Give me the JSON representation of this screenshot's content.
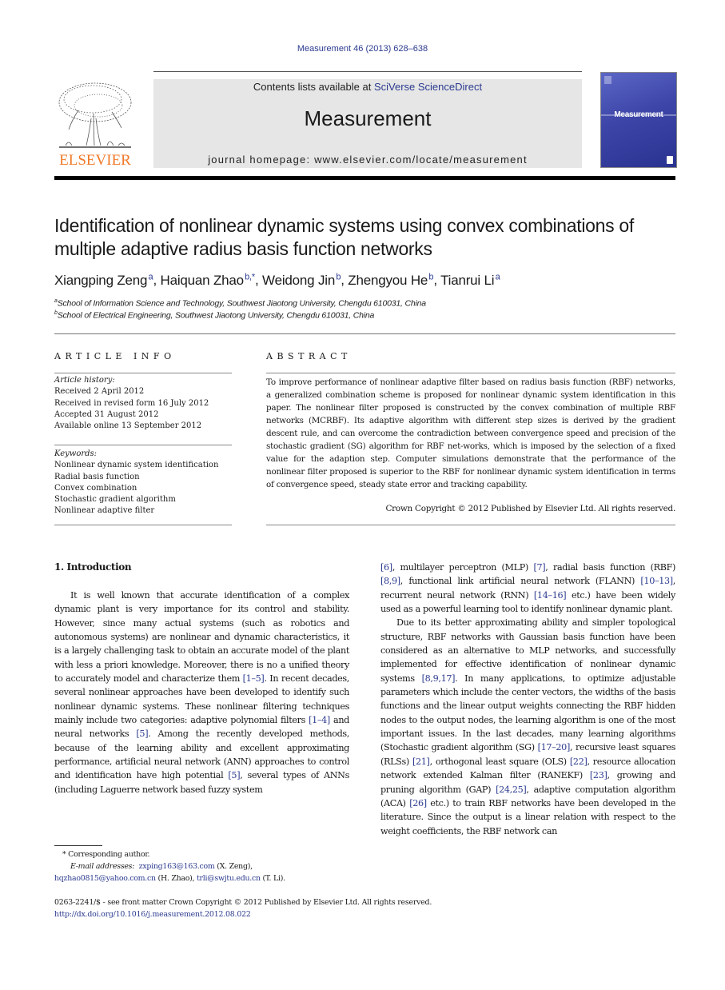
{
  "citation": "Measurement 46 (2013) 628–638",
  "masthead": {
    "contents_prefix": "Contents lists available at ",
    "contents_link": "SciVerse ScienceDirect",
    "journal_title": "Measurement",
    "homepage": "journal homepage: www.elsevier.com/locate/measurement",
    "publisher_wordmark": "ELSEVIER",
    "cover_title": "Measurement",
    "brand_color": "#f07a2a",
    "link_color": "#2b3a8f"
  },
  "article": {
    "title": "Identification of nonlinear dynamic systems using convex combinations of multiple adaptive radius basis function networks",
    "authors": [
      {
        "name": "Xiangping Zeng",
        "sup": "a"
      },
      {
        "name": "Haiquan Zhao",
        "sup": "b,*"
      },
      {
        "name": "Weidong Jin",
        "sup": "b"
      },
      {
        "name": "Zhengyou He",
        "sup": "b"
      },
      {
        "name": "Tianrui Li",
        "sup": "a"
      }
    ],
    "affiliations": [
      {
        "mark": "a",
        "text": "School of Information Science and Technology, Southwest Jiaotong University, Chengdu 610031, China"
      },
      {
        "mark": "b",
        "text": "School of Electrical Engineering, Southwest Jiaotong University, Chengdu 610031, China"
      }
    ]
  },
  "article_info": {
    "heading": "ARTICLE INFO",
    "history_label": "Article history:",
    "history": [
      "Received 2 April 2012",
      "Received in revised form 16 July 2012",
      "Accepted 31 August 2012",
      "Available online 13 September 2012"
    ],
    "keywords_label": "Keywords:",
    "keywords": [
      "Nonlinear dynamic system identification",
      "Radial basis function",
      "Convex combination",
      "Stochastic gradient algorithm",
      "Nonlinear adaptive filter"
    ]
  },
  "abstract": {
    "heading": "ABSTRACT",
    "text": "To improve performance of nonlinear adaptive filter based on radius basis function (RBF) networks, a generalized combination scheme is proposed for nonlinear dynamic system identification in this paper. The nonlinear filter proposed is constructed by the convex combination of multiple RBF networks (MCRBF). Its adaptive algorithm with different step sizes is derived by the gradient descent rule, and can overcome the contradiction between convergence speed and precision of the stochastic gradient (SG) algorithm for RBF net-works, which is imposed by the selection of a fixed value for the adaption step. Computer simulations demonstrate that the performance of the nonlinear filter proposed is superior to the RBF for nonlinear dynamic system identification in terms of convergence speed, steady state error and tracking capability.",
    "copyright": "Crown Copyright © 2012 Published by Elsevier Ltd. All rights reserved."
  },
  "introduction": {
    "heading": "1. Introduction",
    "p1": [
      {
        "t": "It is well known that accurate identification of a complex dynamic plant is very importance for its control and stability. However, since many actual systems (such as robotics and autonomous systems) are nonlinear and dynamic characteristics, it is a largely challenging task to obtain an accurate model of the plant with less a priori knowledge. Moreover, there is no a unified theory to accurately model and characterize them "
      },
      {
        "ref": "[1–5]"
      },
      {
        "t": ". In recent decades, several nonlinear approaches have been developed to identify such nonlinear dynamic systems. These nonlinear filtering techniques mainly include two categories: adaptive polynomial filters "
      },
      {
        "ref": "[1–4]"
      },
      {
        "t": " and neural networks "
      },
      {
        "ref": "[5]"
      },
      {
        "t": ". Among the recently developed methods, because of the learning ability and excellent approximating performance, artificial neural network (ANN) approaches to control and identification have high potential "
      },
      {
        "ref": "[5]"
      },
      {
        "t": ", several types of ANNs (including Laguerre network based fuzzy system "
      }
    ],
    "p1_cont": [
      {
        "ref": "[6]"
      },
      {
        "t": ", multilayer perceptron (MLP) "
      },
      {
        "ref": "[7]"
      },
      {
        "t": ", radial basis function (RBF) "
      },
      {
        "ref": "[8,9]"
      },
      {
        "t": ", functional link artificial neural network (FLANN) "
      },
      {
        "ref": "[10–13]"
      },
      {
        "t": ", recurrent neural network (RNN) "
      },
      {
        "ref": "[14–16]"
      },
      {
        "t": " etc.) have been widely used as a powerful learning tool to identify nonlinear dynamic plant."
      }
    ],
    "p2": [
      {
        "t": "Due to its better approximating ability and simpler topological structure, RBF networks with Gaussian basis function have been considered as an alternative to MLP networks, and successfully implemented for effective identification of nonlinear dynamic systems "
      },
      {
        "ref": "[8,9,17]"
      },
      {
        "t": ". In many applications, to optimize adjustable parameters which include the center vectors, the widths of the basis functions and the linear output weights connecting the RBF hidden nodes to the output nodes, the learning algorithm is one of the most important issues. In the last decades, many learning algorithms (Stochastic gradient algorithm (SG) "
      },
      {
        "ref": "[17–20]"
      },
      {
        "t": ", recursive least squares (RLSs) "
      },
      {
        "ref": "[21]"
      },
      {
        "t": ", orthogonal least square (OLS) "
      },
      {
        "ref": "[22]"
      },
      {
        "t": ", resource allocation network extended Kalman filter (RANEKF) "
      },
      {
        "ref": "[23]"
      },
      {
        "t": ", growing and pruning algorithm (GAP) "
      },
      {
        "ref": "[24,25]"
      },
      {
        "t": ", adaptive computation algorithm (ACA) "
      },
      {
        "ref": "[26]"
      },
      {
        "t": " etc.) to train RBF networks have been developed in the literature. Since the output is a linear relation with respect to the weight coefficients, the RBF network can"
      }
    ]
  },
  "footnotes": {
    "corresponding": "* Corresponding author.",
    "email_label": "E-mail addresses:",
    "emails": [
      {
        "addr": "zxping163@163.com",
        "who": " (X. Zeng), "
      },
      {
        "addr": "hqzhao0815@yahoo.com.cn",
        "who": " (H. Zhao), "
      },
      {
        "addr": "trli@swjtu.edu.cn",
        "who": " (T. Li)."
      }
    ]
  },
  "front_matter": {
    "issn_line": "0263-2241/$ - see front matter Crown Copyright © 2012 Published by Elsevier Ltd. All rights reserved.",
    "doi": "http://dx.doi.org/10.1016/j.measurement.2012.08.022"
  }
}
